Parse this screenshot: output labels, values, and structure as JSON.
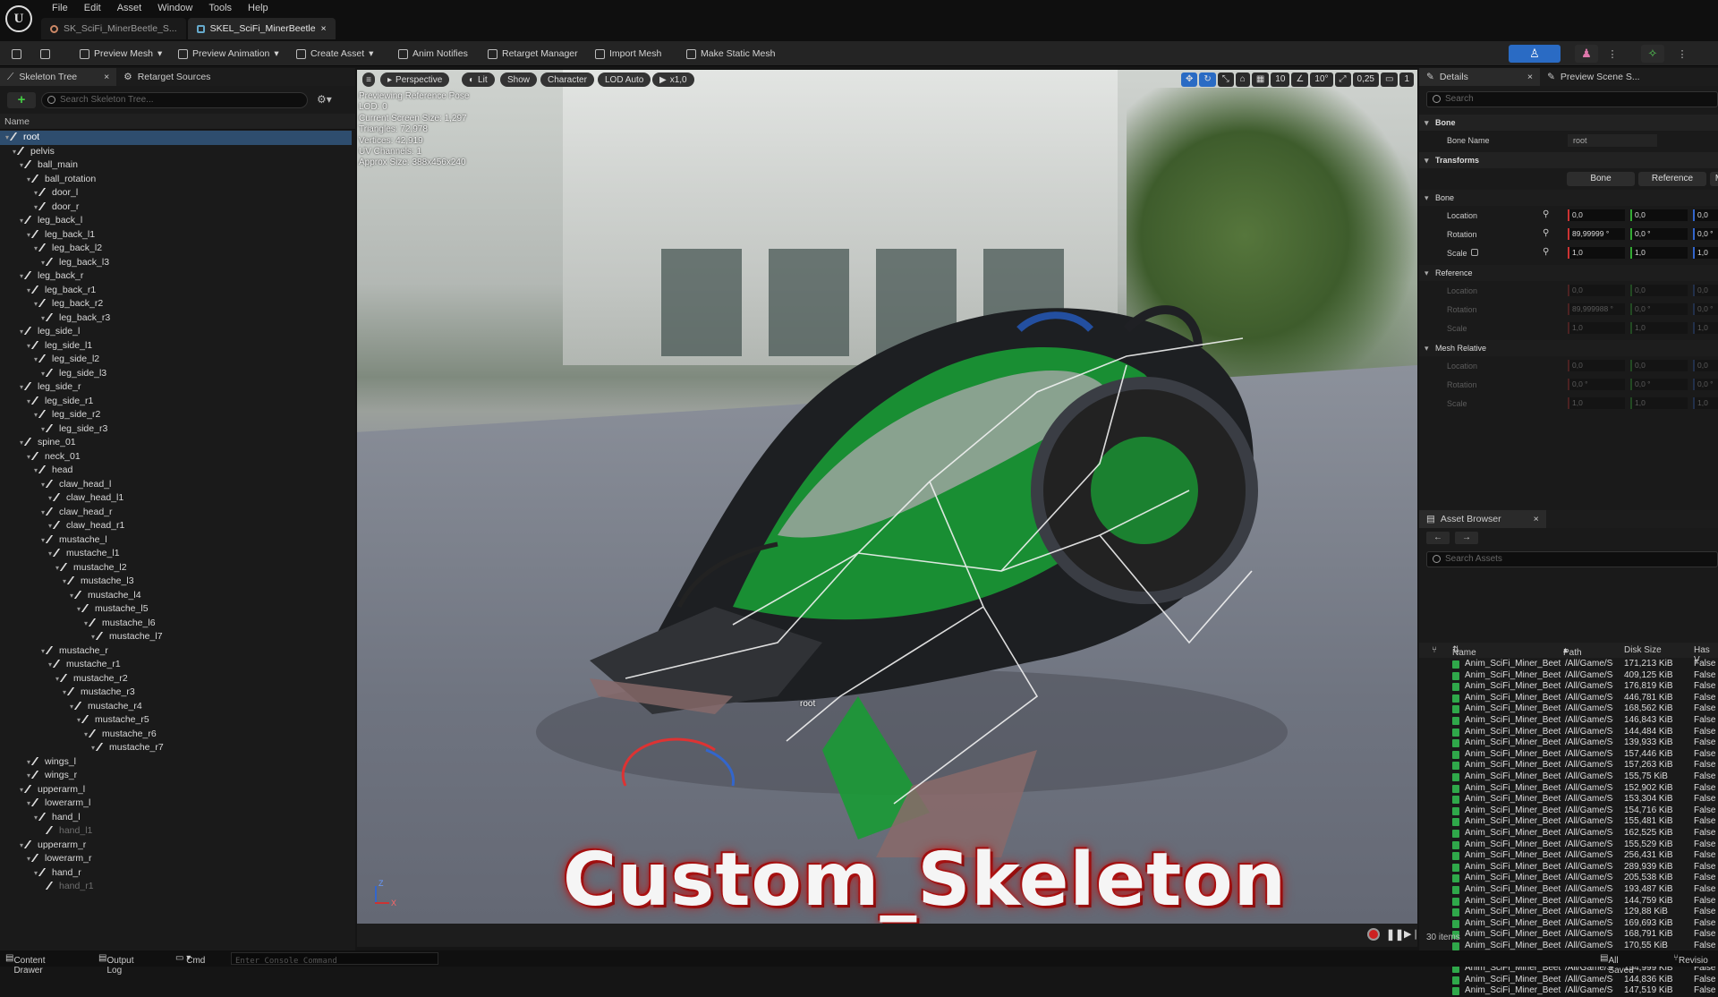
{
  "menu": [
    "File",
    "Edit",
    "Asset",
    "Window",
    "Tools",
    "Help"
  ],
  "doc_tabs": [
    {
      "label": "SK_SciFi_MinerBeetle_S...",
      "active": false
    },
    {
      "label": "SKEL_SciFi_MinerBeetle",
      "close": "×",
      "active": true
    }
  ],
  "toolbar": {
    "preview_mesh": "Preview Mesh",
    "preview_animation": "Preview Animation",
    "create_asset": "Create Asset",
    "anim_notifies": "Anim Notifies",
    "retarget_manager": "Retarget Manager",
    "import_mesh": "Import Mesh",
    "make_static_mesh": "Make Static Mesh"
  },
  "left_panel": {
    "tab_skeleton_tree": "Skeleton Tree",
    "tab_retarget_sources": "Retarget Sources",
    "search_placeholder": "Search Skeleton Tree...",
    "column_name": "Name",
    "bones": [
      {
        "name": "root",
        "depth": 0,
        "selected": true
      },
      {
        "name": "pelvis",
        "depth": 1
      },
      {
        "name": "ball_main",
        "depth": 2
      },
      {
        "name": "ball_rotation",
        "depth": 3
      },
      {
        "name": "door_l",
        "depth": 4
      },
      {
        "name": "door_r",
        "depth": 4
      },
      {
        "name": "leg_back_l",
        "depth": 2
      },
      {
        "name": "leg_back_l1",
        "depth": 3
      },
      {
        "name": "leg_back_l2",
        "depth": 4
      },
      {
        "name": "leg_back_l3",
        "depth": 5
      },
      {
        "name": "leg_back_r",
        "depth": 2
      },
      {
        "name": "leg_back_r1",
        "depth": 3
      },
      {
        "name": "leg_back_r2",
        "depth": 4
      },
      {
        "name": "leg_back_r3",
        "depth": 5
      },
      {
        "name": "leg_side_l",
        "depth": 2
      },
      {
        "name": "leg_side_l1",
        "depth": 3
      },
      {
        "name": "leg_side_l2",
        "depth": 4
      },
      {
        "name": "leg_side_l3",
        "depth": 5
      },
      {
        "name": "leg_side_r",
        "depth": 2
      },
      {
        "name": "leg_side_r1",
        "depth": 3
      },
      {
        "name": "leg_side_r2",
        "depth": 4
      },
      {
        "name": "leg_side_r3",
        "depth": 5
      },
      {
        "name": "spine_01",
        "depth": 2
      },
      {
        "name": "neck_01",
        "depth": 3
      },
      {
        "name": "head",
        "depth": 4
      },
      {
        "name": "claw_head_l",
        "depth": 5
      },
      {
        "name": "claw_head_l1",
        "depth": 6
      },
      {
        "name": "claw_head_r",
        "depth": 5
      },
      {
        "name": "claw_head_r1",
        "depth": 6
      },
      {
        "name": "mustache_l",
        "depth": 5
      },
      {
        "name": "mustache_l1",
        "depth": 6
      },
      {
        "name": "mustache_l2",
        "depth": 7
      },
      {
        "name": "mustache_l3",
        "depth": 8
      },
      {
        "name": "mustache_l4",
        "depth": 9
      },
      {
        "name": "mustache_l5",
        "depth": 10
      },
      {
        "name": "mustache_l6",
        "depth": 11
      },
      {
        "name": "mustache_l7",
        "depth": 12
      },
      {
        "name": "mustache_r",
        "depth": 5
      },
      {
        "name": "mustache_r1",
        "depth": 6
      },
      {
        "name": "mustache_r2",
        "depth": 7
      },
      {
        "name": "mustache_r3",
        "depth": 8
      },
      {
        "name": "mustache_r4",
        "depth": 9
      },
      {
        "name": "mustache_r5",
        "depth": 10
      },
      {
        "name": "mustache_r6",
        "depth": 11
      },
      {
        "name": "mustache_r7",
        "depth": 12
      },
      {
        "name": "wings_l",
        "depth": 3
      },
      {
        "name": "wings_r",
        "depth": 3
      },
      {
        "name": "upperarm_l",
        "depth": 2
      },
      {
        "name": "lowerarm_l",
        "depth": 3
      },
      {
        "name": "hand_l",
        "depth": 4
      },
      {
        "name": "hand_l1",
        "depth": 5,
        "dim": true
      },
      {
        "name": "upperarm_r",
        "depth": 2
      },
      {
        "name": "lowerarm_r",
        "depth": 3
      },
      {
        "name": "hand_r",
        "depth": 4
      },
      {
        "name": "hand_r1",
        "depth": 5,
        "dim": true
      }
    ]
  },
  "viewport": {
    "perspective": "Perspective",
    "lit": "Lit",
    "show": "Show",
    "character": "Character",
    "lod": "LOD Auto",
    "play_rate": "x1,0",
    "info_lines": [
      "Previewing Reference Pose",
      "LOD: 0",
      "Current Screen Size: 1,297",
      "Triangles: 72,978",
      "Vertices: 42,919",
      "UV Channels: 1",
      "Approx Size: 388x456x240"
    ],
    "right_controls": [
      "10",
      "10°",
      "0,25",
      "1"
    ],
    "root_label": "root",
    "overlay_title": "Custom_Skeleton",
    "axis_z": "Z",
    "axis_x": "X"
  },
  "details": {
    "tab_details": "Details",
    "tab_preview_scene": "Preview Scene S...",
    "search_placeholder": "Search",
    "section_bone": "Bone",
    "bone_name_label": "Bone Name",
    "bone_name_value": "root",
    "section_transforms": "Transforms",
    "toggle_bone": "Bone",
    "toggle_reference": "Reference",
    "toggle_third": "M",
    "sub_bone": "Bone",
    "location_label": "Location",
    "rotation_label": "Rotation",
    "scale_label": "Scale",
    "bone_location": [
      "0,0",
      "0,0",
      "0,0"
    ],
    "bone_rotation": [
      "89,99999 °",
      "0,0 °",
      "0,0 °"
    ],
    "bone_scale": [
      "1,0",
      "1,0",
      "1,0"
    ],
    "sub_reference": "Reference",
    "ref_location": [
      "0,0",
      "0,0",
      "0,0"
    ],
    "ref_rotation": [
      "89,999988 °",
      "0,0 °",
      "0,0 °"
    ],
    "ref_scale": [
      "1,0",
      "1,0",
      "1,0"
    ],
    "sub_mesh_relative": "Mesh Relative",
    "mr_location": [
      "0,0",
      "0,0",
      "0,0"
    ],
    "mr_rotation": [
      "0,0 °",
      "0,0 °",
      "0,0 °"
    ],
    "mr_scale": [
      "1,0",
      "1,0",
      "1,0"
    ]
  },
  "asset_browser": {
    "tab": "Asset Browser",
    "search_placeholder": "Search Assets",
    "col_name": "Name",
    "col_path": "Path",
    "col_disk": "Disk Size",
    "col_has": "Has V",
    "item_count": "30 items",
    "rows": [
      [
        "Anim_SciFi_Miner_Beet",
        "/All/Game/Sc",
        "171,213 KiB",
        "False"
      ],
      [
        "Anim_SciFi_Miner_Beet",
        "/All/Game/Sc",
        "409,125 KiB",
        "False"
      ],
      [
        "Anim_SciFi_Miner_Beet",
        "/All/Game/Sc",
        "176,819 KiB",
        "False"
      ],
      [
        "Anim_SciFi_Miner_Beet",
        "/All/Game/Sc",
        "446,781 KiB",
        "False"
      ],
      [
        "Anim_SciFi_Miner_Beet",
        "/All/Game/Sc",
        "168,562 KiB",
        "False"
      ],
      [
        "Anim_SciFi_Miner_Beet",
        "/All/Game/Sc",
        "146,843 KiB",
        "False"
      ],
      [
        "Anim_SciFi_Miner_Beet",
        "/All/Game/Sc",
        "144,484 KiB",
        "False"
      ],
      [
        "Anim_SciFi_Miner_Beet",
        "/All/Game/Sc",
        "139,933 KiB",
        "False"
      ],
      [
        "Anim_SciFi_Miner_Beet",
        "/All/Game/Sc",
        "157,446 KiB",
        "False"
      ],
      [
        "Anim_SciFi_Miner_Beet",
        "/All/Game/Sc",
        "157,263 KiB",
        "False"
      ],
      [
        "Anim_SciFi_Miner_Beet",
        "/All/Game/Sc",
        "155,75 KiB",
        "False"
      ],
      [
        "Anim_SciFi_Miner_Beet",
        "/All/Game/Sc",
        "152,902 KiB",
        "False"
      ],
      [
        "Anim_SciFi_Miner_Beet",
        "/All/Game/Sc",
        "153,304 KiB",
        "False"
      ],
      [
        "Anim_SciFi_Miner_Beet",
        "/All/Game/Sc",
        "154,716 KiB",
        "False"
      ],
      [
        "Anim_SciFi_Miner_Beet",
        "/All/Game/Sc",
        "155,481 KiB",
        "False"
      ],
      [
        "Anim_SciFi_Miner_Beet",
        "/All/Game/Sc",
        "162,525 KiB",
        "False"
      ],
      [
        "Anim_SciFi_Miner_Beet",
        "/All/Game/Sc",
        "155,529 KiB",
        "False"
      ],
      [
        "Anim_SciFi_Miner_Beet",
        "/All/Game/Sc",
        "256,431 KiB",
        "False"
      ],
      [
        "Anim_SciFi_Miner_Beet",
        "/All/Game/Sc",
        "289,939 KiB",
        "False"
      ],
      [
        "Anim_SciFi_Miner_Beet",
        "/All/Game/Sc",
        "205,538 KiB",
        "False"
      ],
      [
        "Anim_SciFi_Miner_Beet",
        "/All/Game/Sc",
        "193,487 KiB",
        "False"
      ],
      [
        "Anim_SciFi_Miner_Beet",
        "/All/Game/Sc",
        "144,759 KiB",
        "False"
      ],
      [
        "Anim_SciFi_Miner_Beet",
        "/All/Game/Sc",
        "129,88 KiB",
        "False"
      ],
      [
        "Anim_SciFi_Miner_Beet",
        "/All/Game/Sc",
        "169,693 KiB",
        "False"
      ],
      [
        "Anim_SciFi_Miner_Beet",
        "/All/Game/Sc",
        "168,791 KiB",
        "False"
      ],
      [
        "Anim_SciFi_Miner_Beet",
        "/All/Game/Sc",
        "170,55 KiB",
        "False"
      ],
      [
        "Anim_SciFi_Miner_Beet",
        "/All/Game/Sc",
        "146,038 KiB",
        "False"
      ],
      [
        "Anim_SciFi_Miner_Beet",
        "/All/Game/Sc",
        "154,999 KiB",
        "False"
      ],
      [
        "Anim_SciFi_Miner_Beet",
        "/All/Game/Sc",
        "144,836 KiB",
        "False"
      ],
      [
        "Anim_SciFi_Miner_Beet",
        "/All/Game/Sc",
        "147,519 KiB",
        "False"
      ]
    ]
  },
  "statusbar": {
    "content_drawer": "Content Drawer",
    "output_log": "Output Log",
    "cmd": "Cmd",
    "console_placeholder": "Enter Console Command",
    "all_saved": "All Saved",
    "revision": "Revisio"
  },
  "colors": {
    "accent_blue": "#2a6bc4",
    "selection": "#2e4d6e",
    "asset_icon_green": "#2fa84a",
    "title_glow": "#c01a1a"
  }
}
